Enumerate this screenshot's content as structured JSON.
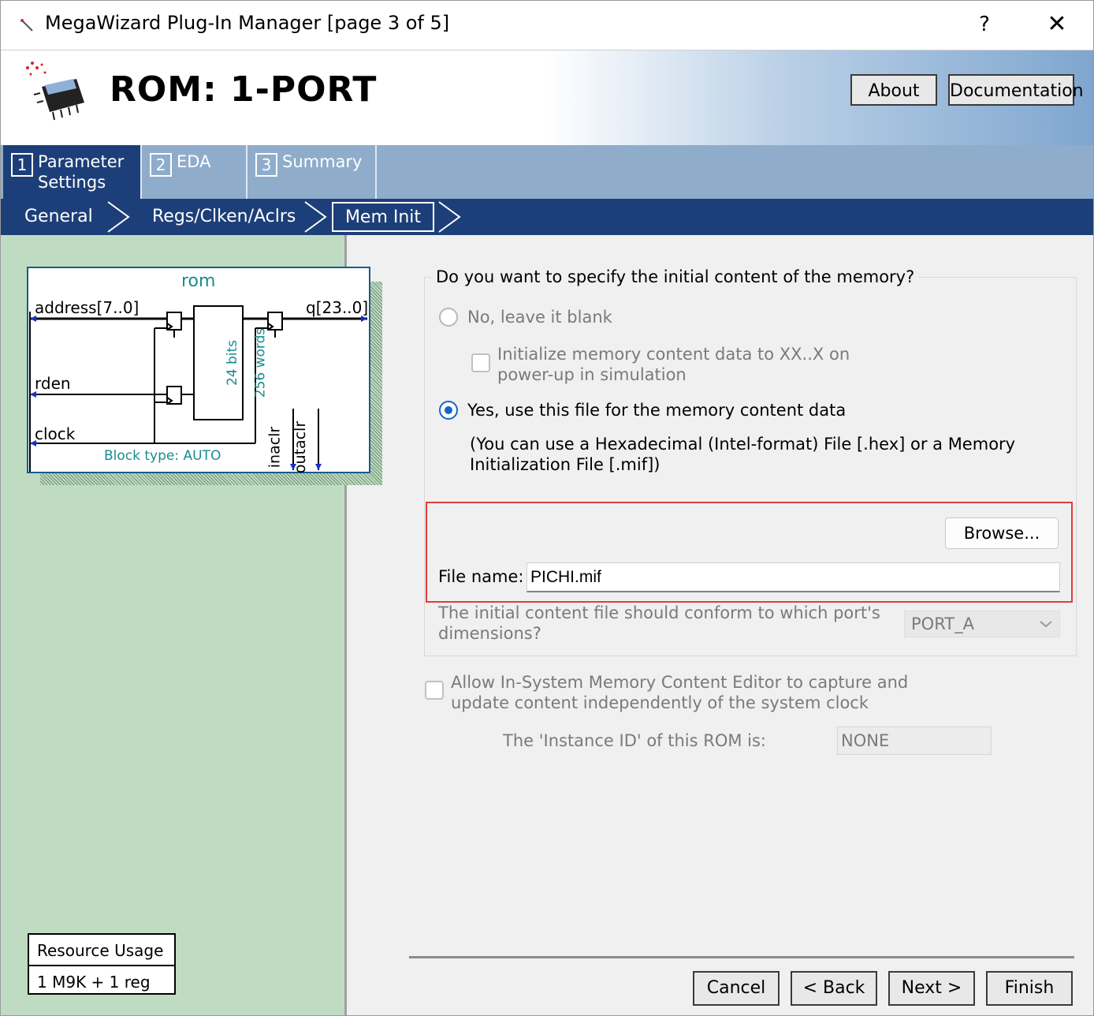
{
  "window": {
    "title": "MegaWizard Plug-In Manager [page 3 of 5]",
    "help_label": "?",
    "close_label": "✕"
  },
  "header": {
    "product_title": "ROM: 1-PORT",
    "about_label": "About",
    "documentation_label": "Documentation"
  },
  "tabs": [
    {
      "num": "1",
      "label": "Parameter",
      "label2": "Settings"
    },
    {
      "num": "2",
      "label": "EDA"
    },
    {
      "num": "3",
      "label": "Summary"
    }
  ],
  "subtabs": [
    "General",
    "Regs/Clken/Aclrs",
    "Mem Init"
  ],
  "diagram": {
    "name": "rom",
    "address": "address[7..0]",
    "q": "q[23..0]",
    "rden": "rden",
    "clock": "clock",
    "bits": "24 bits",
    "words": "256 words",
    "block_type": "Block type: AUTO",
    "inaclr": "inaclr",
    "outaclr": "outaclr"
  },
  "resource": {
    "title": "Resource Usage",
    "value": "1 M9K + 1 reg"
  },
  "mem_init": {
    "question": "Do you want to specify the initial content of the memory?",
    "no_option": "No, leave it blank",
    "init_xx_line1": "Initialize memory content data to XX..X on",
    "init_xx_line2": "power-up in simulation",
    "yes_option": "Yes, use this file for the memory content data",
    "hint_line1": "(You can use a Hexadecimal (Intel-format) File [.hex] or a Memory",
    "hint_line2": "Initialization File [.mif])",
    "browse_label": "Browse...",
    "file_name_label": "File name:",
    "file_name_value": "PICHI.mif",
    "port_question_line1": "The initial content file should conform to which port's",
    "port_question_line2": "dimensions?",
    "port_value": "PORT_A",
    "allow_editor_line1": "Allow In-System Memory Content Editor to capture and",
    "allow_editor_line2": "update content independently of the system clock",
    "instance_id_label": "The 'Instance ID' of this ROM is:",
    "instance_id_value": "NONE"
  },
  "footer": {
    "cancel": "Cancel",
    "back": "< Back",
    "next": "Next >",
    "finish": "Finish"
  }
}
